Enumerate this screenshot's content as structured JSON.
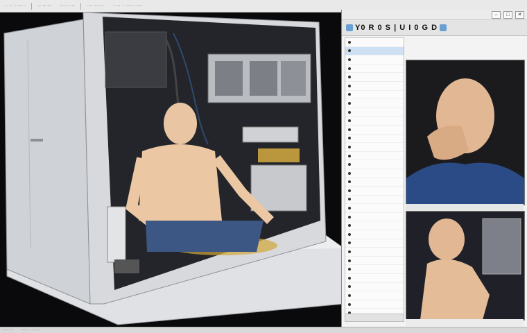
{
  "topbar": {
    "items": [
      "· · ·· ·······",
      "·· ······",
      "······ ···",
      "··· ·······",
      "· ···· · ····· ·····"
    ]
  },
  "app": {
    "toolbar_text": "Y0 R 0 S | U  I 0 G D",
    "window_buttons": {
      "minimize": "–",
      "restore": "□",
      "close": "✕"
    },
    "left_panel_rows": [
      "",
      "",
      "",
      "",
      "",
      "",
      "",
      "",
      "",
      "",
      "",
      "",
      "",
      "",
      "",
      "",
      "",
      "",
      "",
      "",
      "",
      "",
      "",
      "",
      "",
      "",
      "",
      "",
      "",
      "",
      "",
      "",
      "",
      "",
      ""
    ],
    "footer_text": ""
  },
  "status": {
    "items": [
      "···· ···",
      "······ ·······"
    ]
  },
  "colors": {
    "accent": "#6a9fd3",
    "cabinet": "#d9dbde",
    "floor": "#e6e6e8"
  }
}
